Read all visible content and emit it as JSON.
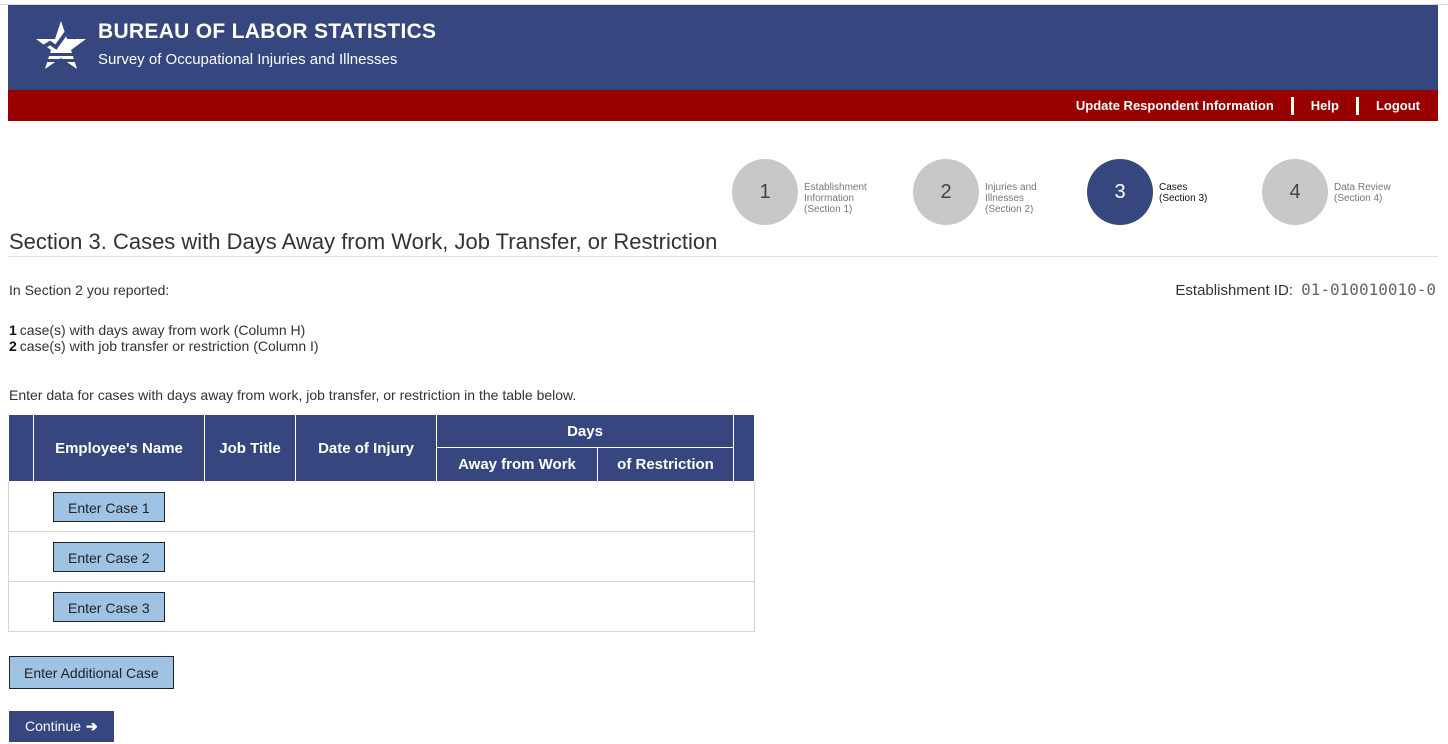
{
  "header": {
    "agency": "BUREAU OF LABOR STATISTICS",
    "subtitle": "Survey of Occupational Injuries and Illnesses",
    "logo_icon": "bls-star-logo"
  },
  "nav": {
    "links": [
      "Update Respondent Information",
      "Help",
      "Logout"
    ]
  },
  "steps": [
    {
      "number": "1",
      "line1": "Establishment",
      "line2": "Information",
      "line3": "(Section 1)"
    },
    {
      "number": "2",
      "line1": "Injuries and",
      "line2": "Illnesses",
      "line3": "(Section 2)"
    },
    {
      "number": "3",
      "line1": "Cases",
      "line2": "(Section 3)",
      "line3": ""
    },
    {
      "number": "4",
      "line1": "Data Review",
      "line2": "(Section 4)",
      "line3": ""
    }
  ],
  "active_step": "3",
  "page": {
    "title": "Section 3. Cases with Days Away from Work, Job Transfer, or Restriction",
    "intro": "In Section 2 you reported:",
    "establishment_label": "Establishment ID:",
    "establishment_id": "01-010010010-0",
    "counts": [
      {
        "num": "1",
        "text": "case(s) with days away from work (Column H)"
      },
      {
        "num": "2",
        "text": "case(s) with job transfer or restriction (Column I)"
      }
    ],
    "instructions": "Enter data for cases with days away from work, job transfer, or restriction in the table below."
  },
  "table": {
    "headers": {
      "name": "Employee's Name",
      "job": "Job Title",
      "date": "Date of Injury",
      "days": "Days",
      "away": "Away from Work",
      "restriction": "of Restriction"
    },
    "rows": [
      {
        "button": "Enter Case 1"
      },
      {
        "button": "Enter Case 2"
      },
      {
        "button": "Enter Case 3"
      }
    ]
  },
  "buttons": {
    "add_case": "Enter Additional Case",
    "continue": "Continue",
    "continue_icon": "arrow-right-icon"
  },
  "colors": {
    "header_blue": "#36467f",
    "nav_red": "#990000",
    "button_blue": "#9ec3e4",
    "step_inactive": "#c8c8c8"
  }
}
